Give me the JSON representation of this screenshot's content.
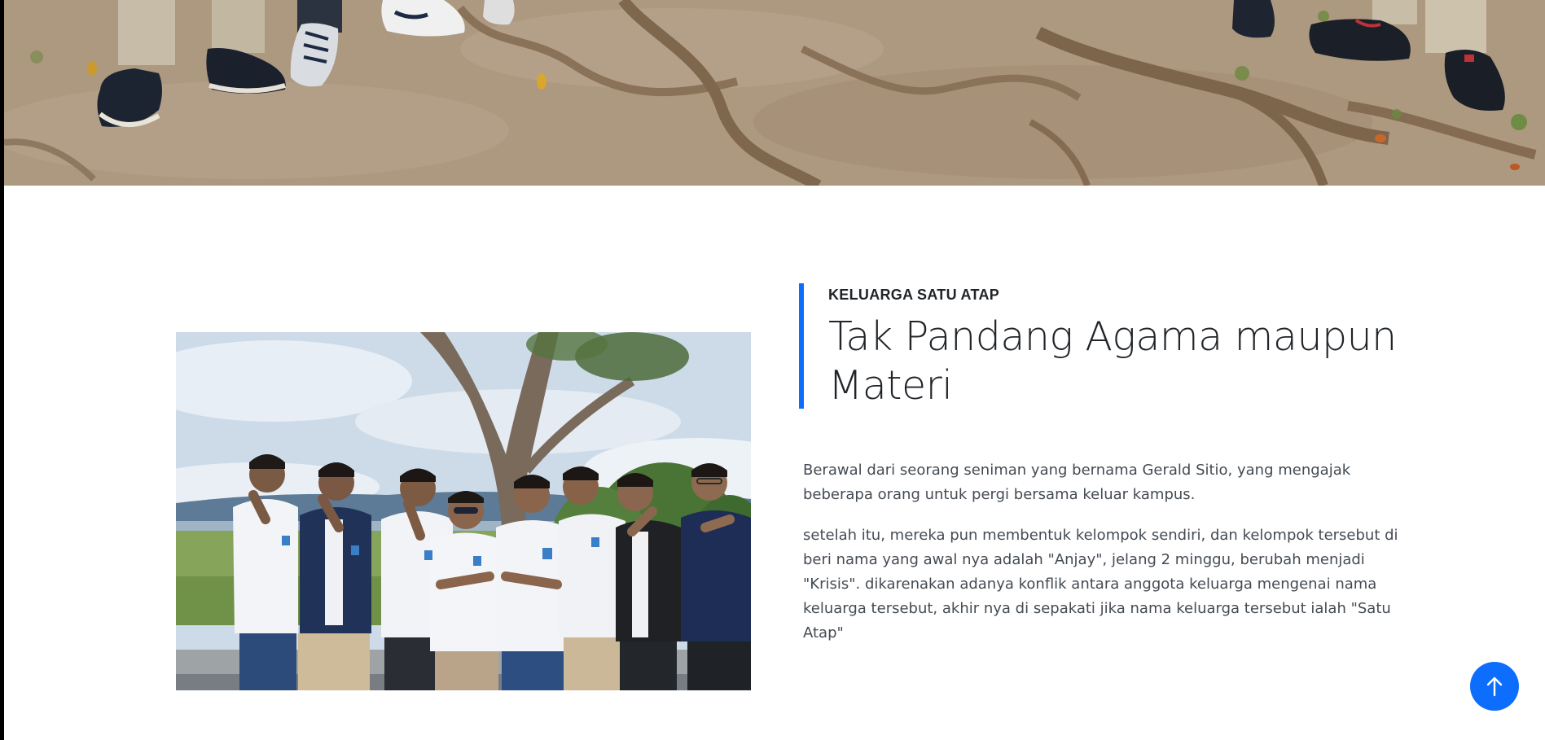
{
  "hero": {
    "image_name": "ground-with-feet-and-roots-photo"
  },
  "about": {
    "subtitle": "KELUARGA SATU ATAP",
    "title": "Tak Pandang Agama maupun Materi",
    "paragraphs": [
      "Berawal dari seorang seniman yang bernama Gerald Sitio, yang mengajak beberapa orang untuk pergi bersama keluar kampus.",
      "setelah itu, mereka pun membentuk kelompok sendiri, dan kelompok tersebut di beri nama yang awal nya adalah \"Anjay\", jelang 2 minggu, berubah menjadi \"Krisis\". dikarenakan adanya konflik antara anggota keluarga mengenai nama keluarga tersebut, akhir nya di sepakati jika nama keluarga tersebut ialah \"Satu Atap\""
    ],
    "photo_name": "group-photo"
  },
  "back_to_top": {
    "icon": "arrow-up-icon"
  },
  "colors": {
    "accent": "#0d6efd",
    "text": "#212529",
    "body_text": "#444b53"
  }
}
